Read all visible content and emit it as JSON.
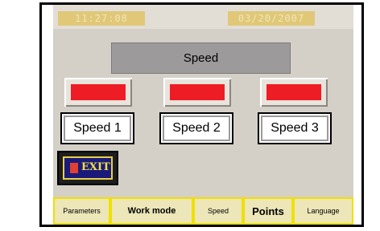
{
  "header": {
    "time": "11:27:08",
    "date": "03/20/2007"
  },
  "main": {
    "title": "Speed",
    "speed_buttons": [
      "Speed 1",
      "Speed 2",
      "Speed 3"
    ],
    "indicator_color": "#ee1c24",
    "exit_label": "EXIT"
  },
  "nav": {
    "tabs": [
      "Parameters",
      "Work mode",
      "Speed",
      "Points",
      "Language"
    ]
  }
}
